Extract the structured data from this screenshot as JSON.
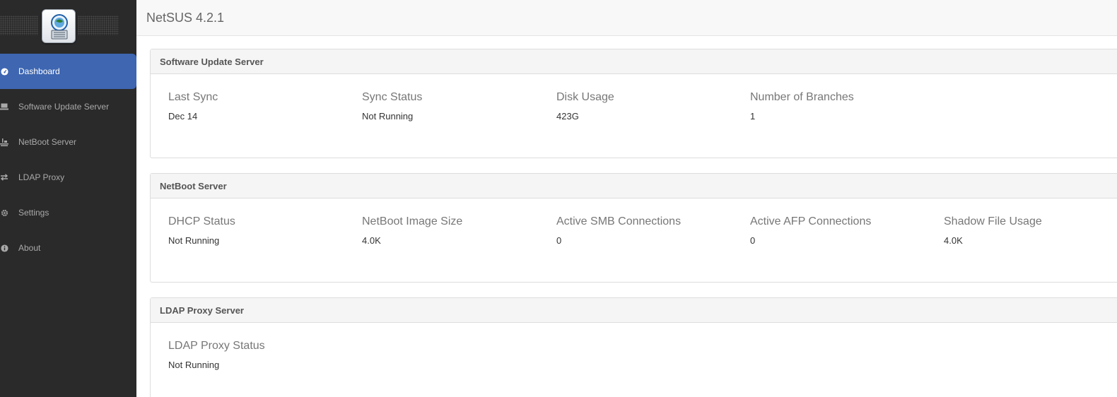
{
  "app": {
    "title": "NetSUS 4.2.1"
  },
  "sidebar": {
    "logo": "netsus-logo",
    "items": [
      {
        "label": "Dashboard",
        "icon": "dashboard-icon",
        "active": true
      },
      {
        "label": "Software Update Server",
        "icon": "laptop-icon",
        "active": false
      },
      {
        "label": "NetBoot Server",
        "icon": "netboot-icon",
        "active": false
      },
      {
        "label": "LDAP Proxy",
        "icon": "exchange-icon",
        "active": false
      },
      {
        "label": "Settings",
        "icon": "gear-icon",
        "active": false
      },
      {
        "label": "About",
        "icon": "info-icon",
        "active": false
      }
    ]
  },
  "panels": {
    "sus": {
      "heading": "Software Update Server",
      "stats": [
        {
          "label": "Last Sync",
          "value": "Dec 14"
        },
        {
          "label": "Sync Status",
          "value": "Not Running"
        },
        {
          "label": "Disk Usage",
          "value": "423G"
        },
        {
          "label": "Number of Branches",
          "value": "1"
        }
      ]
    },
    "netboot": {
      "heading": "NetBoot Server",
      "stats": [
        {
          "label": "DHCP Status",
          "value": "Not Running"
        },
        {
          "label": "NetBoot Image Size",
          "value": "4.0K"
        },
        {
          "label": "Active SMB Connections",
          "value": "0"
        },
        {
          "label": "Active AFP Connections",
          "value": "0"
        },
        {
          "label": "Shadow File Usage",
          "value": "4.0K"
        }
      ]
    },
    "ldap": {
      "heading": "LDAP Proxy Server",
      "stats": [
        {
          "label": "LDAP Proxy Status",
          "value": "Not Running"
        }
      ]
    }
  },
  "colors": {
    "sidebar_bg": "#2a2a2a",
    "active_accent": "#3e66b1",
    "header_bg": "#f8f8f8"
  }
}
